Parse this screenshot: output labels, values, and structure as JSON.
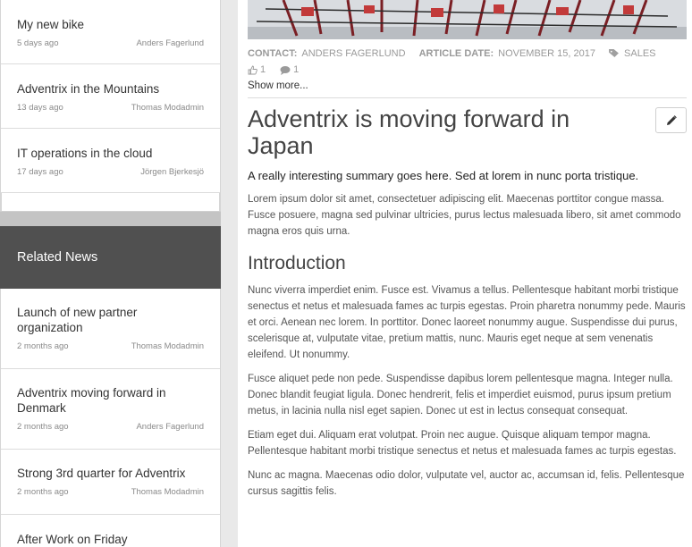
{
  "top_news": [
    {
      "title": "My new bike",
      "age": "5 days ago",
      "author": "Anders Fagerlund"
    },
    {
      "title": "Adventrix in the Mountains",
      "age": "13 days ago",
      "author": "Thomas Modadmin"
    },
    {
      "title": "IT operations in the cloud",
      "age": "17 days ago",
      "author": "Jörgen Bjerkesjö"
    }
  ],
  "related": {
    "heading": "Related News",
    "items": [
      {
        "title": "Launch of new partner organization",
        "age": "2 months ago",
        "author": "Thomas Modadmin"
      },
      {
        "title": "Adventrix moving forward in Denmark",
        "age": "2 months ago",
        "author": "Anders Fagerlund"
      },
      {
        "title": "Strong 3rd quarter for Adventrix",
        "age": "2 months ago",
        "author": "Thomas Modadmin"
      },
      {
        "title": "After Work on Friday",
        "age": "",
        "author": ""
      }
    ]
  },
  "article": {
    "contact_label": "CONTACT:",
    "contact": "ANDERS FAGERLUND",
    "date_label": "ARTICLE DATE:",
    "date": "NOVEMBER 15, 2017",
    "tag": "SALES",
    "likes": "1",
    "comments": "1",
    "show_more": "Show more...",
    "title": "Adventrix is moving forward in Japan",
    "summary": "A really interesting summary goes here. Sed at lorem in nunc porta tristique.",
    "intro_paragraph": "Lorem ipsum dolor sit amet, consectetuer adipiscing elit. Maecenas porttitor congue massa. Fusce posuere, magna sed pulvinar ultricies, purus lectus malesuada libero, sit amet commodo magna eros quis urna.",
    "section_heading": "Introduction",
    "paragraphs": [
      "Nunc viverra imperdiet enim. Fusce est. Vivamus a tellus. Pellentesque habitant morbi tristique senectus et netus et malesuada fames ac turpis egestas. Proin pharetra nonummy pede. Mauris et orci. Aenean nec lorem. In porttitor. Donec laoreet nonummy augue. Suspendisse dui purus, scelerisque at, vulputate vitae, pretium mattis, nunc. Mauris eget neque at sem venenatis eleifend. Ut nonummy.",
      "Fusce aliquet pede non pede. Suspendisse dapibus lorem pellentesque magna. Integer nulla. Donec blandit feugiat ligula. Donec hendrerit, felis et imperdiet euismod, purus ipsum pretium metus, in lacinia nulla nisl eget sapien. Donec ut est in lectus consequat consequat.",
      "Etiam eget dui. Aliquam erat volutpat. Proin nec augue. Quisque aliquam tempor magna. Pellentesque habitant morbi tristique senectus et netus et malesuada fames ac turpis egestas.",
      "Nunc ac magna. Maecenas odio dolor, vulputate vel, auctor ac, accumsan id, felis. Pellentesque cursus sagittis felis."
    ]
  },
  "icons": {
    "like": "thumbs-up-icon",
    "comment": "comment-icon",
    "tag": "tag-icon",
    "edit": "pencil-icon"
  },
  "colors": {
    "related_header_bg": "#505050",
    "sidebar_bg": "#e9e9e9",
    "meta_text": "#9a9a9a"
  }
}
